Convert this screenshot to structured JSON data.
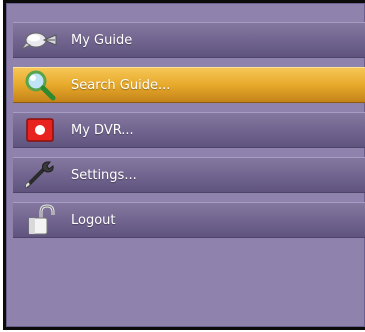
{
  "menu": {
    "items": [
      {
        "label": "My Guide",
        "icon": "satellite-icon",
        "selected": false
      },
      {
        "label": "Search Guide...",
        "icon": "magnifier-icon",
        "selected": true
      },
      {
        "label": "My DVR...",
        "icon": "record-icon",
        "selected": false
      },
      {
        "label": "Settings...",
        "icon": "wrench-icon",
        "selected": false
      },
      {
        "label": "Logout",
        "icon": "padlock-icon",
        "selected": false
      }
    ]
  },
  "colors": {
    "panel": "#8f82ad",
    "item": "#70648e",
    "selected": "#e7a92b",
    "text": "#ffffff"
  }
}
